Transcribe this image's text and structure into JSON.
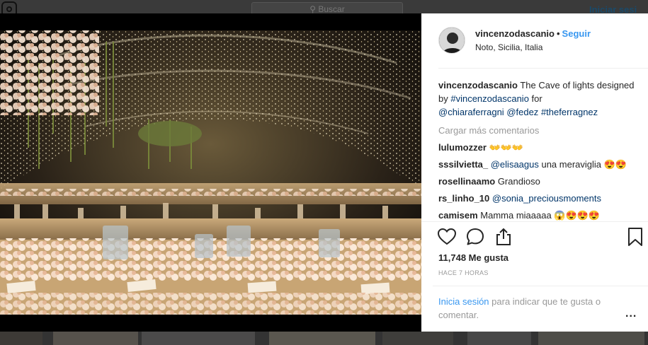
{
  "background": {
    "search_placeholder": "Buscar",
    "login_label": "Iniciar sesi"
  },
  "post": {
    "username": "vincenzodascanio",
    "separator": "•",
    "follow_label": "Seguir",
    "location": "Noto, Sicilia, Italia",
    "caption": {
      "username": "vincenzodascanio",
      "text": " The Cave of lights designed by ",
      "tag1": "#vincenzodascanio",
      "text2": " for ",
      "tag2": "@chiaraferragni",
      "tag3": "@fedez",
      "tag4": "#theferragnez"
    },
    "load_more": "Cargar más comentarios",
    "comments": [
      {
        "user": "lulumozzer",
        "mention": "",
        "text": " 👐👐👐"
      },
      {
        "user": "sssilvietta_",
        "mention": "@elisaagus",
        "text": " una meraviglia 😍😍"
      },
      {
        "user": "rosellinaamo",
        "mention": "",
        "text": " Grandioso"
      },
      {
        "user": "rs_linho_10",
        "mention": "@sonia_preciousmoments",
        "text": ""
      },
      {
        "user": "camisem",
        "mention": "",
        "text": " Mamma miaaaaa 😱😍😍😍"
      }
    ],
    "likes": "11,748 Me gusta",
    "time": "HACE 7 HORAS",
    "login_prompt_link": "Inicia sesión",
    "login_prompt_text": " para indicar que te gusta o comentar.",
    "more_options": "..."
  },
  "icons": [
    "heart-icon",
    "comment-icon",
    "share-icon",
    "bookmark-icon",
    "instagram-logo-icon"
  ],
  "colors": {
    "link": "#3897f0",
    "hashtag": "#003569",
    "muted": "#999999",
    "text": "#262626"
  }
}
